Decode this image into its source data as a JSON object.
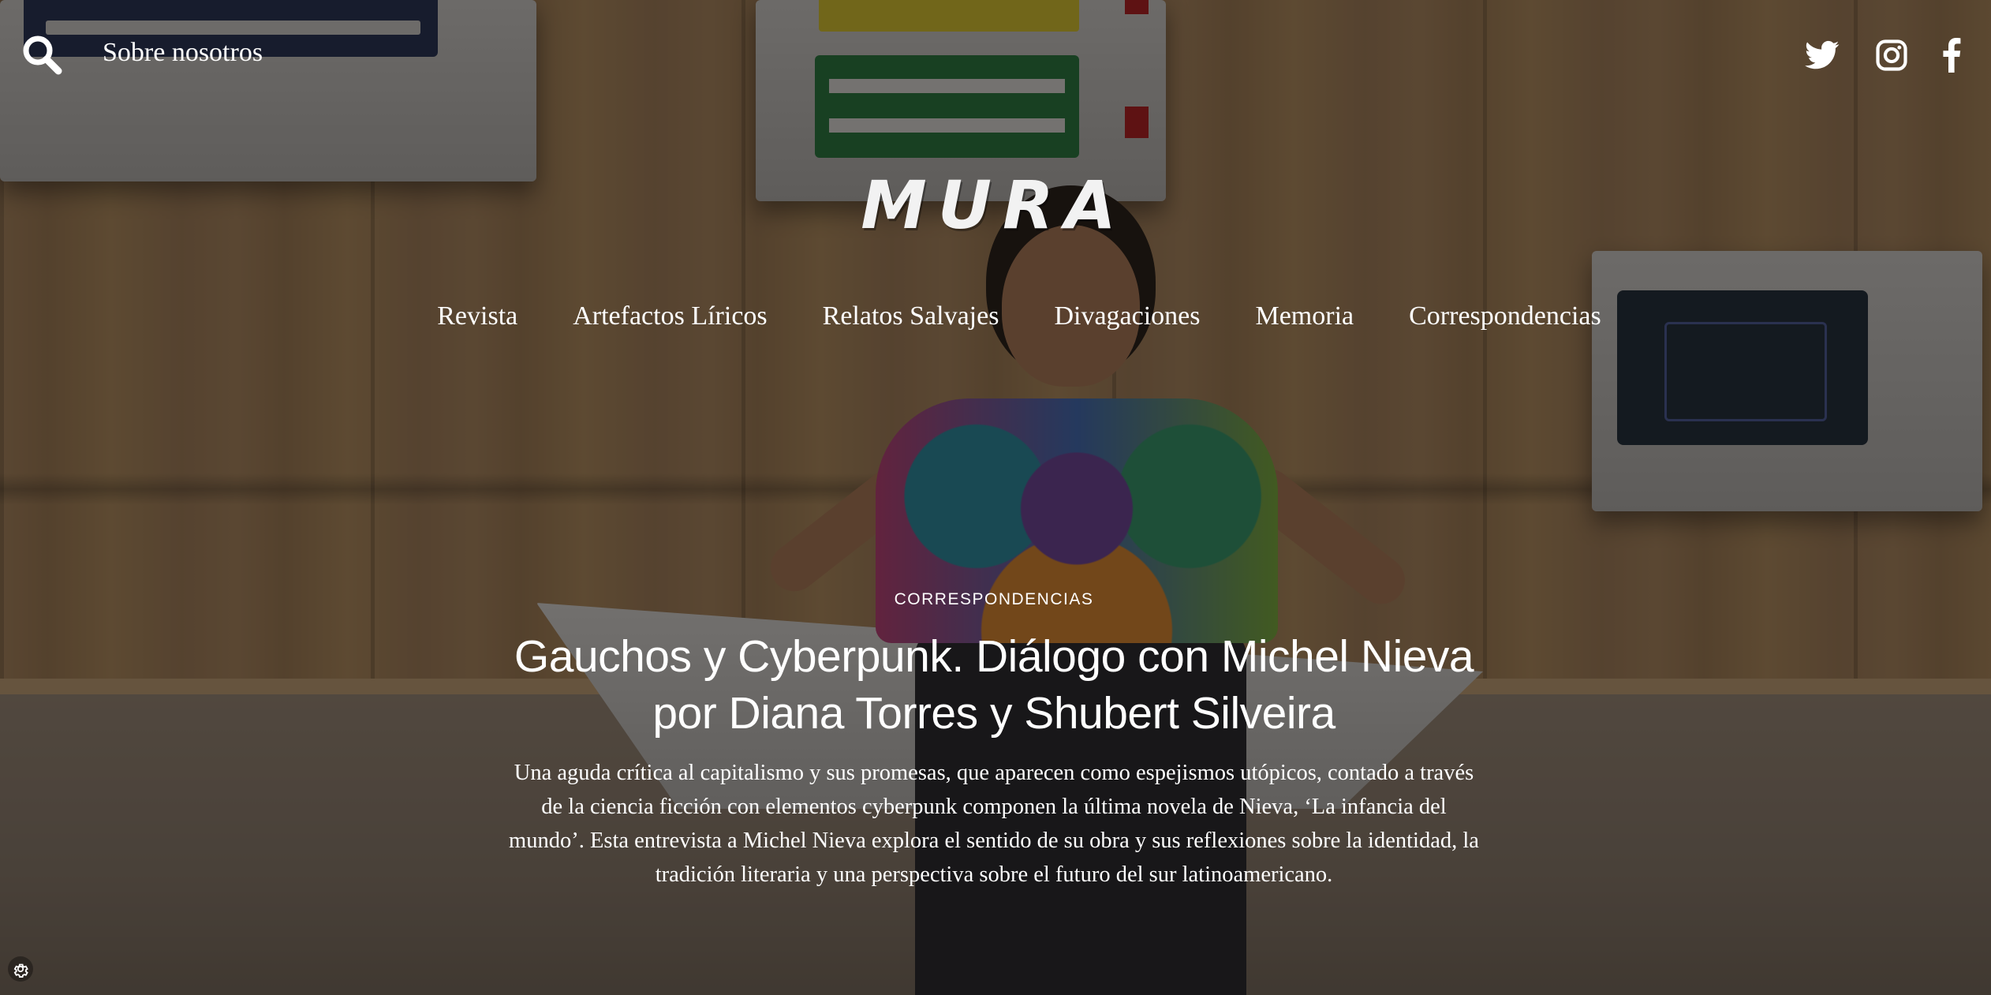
{
  "header": {
    "search_label": "search",
    "about_label": "Sobre nosotros",
    "logo_text": "MURA",
    "social": {
      "twitter": "twitter-icon",
      "instagram": "instagram-icon",
      "facebook": "facebook-icon"
    }
  },
  "nav": {
    "items": [
      {
        "label": "Revista"
      },
      {
        "label": "Artefactos Líricos"
      },
      {
        "label": "Relatos Salvajes"
      },
      {
        "label": "Divagaciones"
      },
      {
        "label": "Memoria"
      },
      {
        "label": "Correspondencias"
      }
    ]
  },
  "featured": {
    "category": "CORRESPONDENCIAS",
    "title_line1": "Gauchos y Cyberpunk. Diálogo con Michel Nieva",
    "title_line2": "por Diana Torres y Shubert Silveira",
    "excerpt": "Una aguda crítica al capitalismo y sus promesas, que aparecen como espejismos utópicos, contado a través de la ciencia ficción con elementos cyberpunk componen la última novela de Nieva, ‘La infancia del mundo’. Esta entrevista a Michel Nieva explora el sentido de su obra y sus reflexiones sobre la identidad, la tradición literaria y una perspectiva sobre el futuro del sur latinoamericano."
  },
  "colors": {
    "text": "#ffffff",
    "overlay": "#14100c"
  }
}
